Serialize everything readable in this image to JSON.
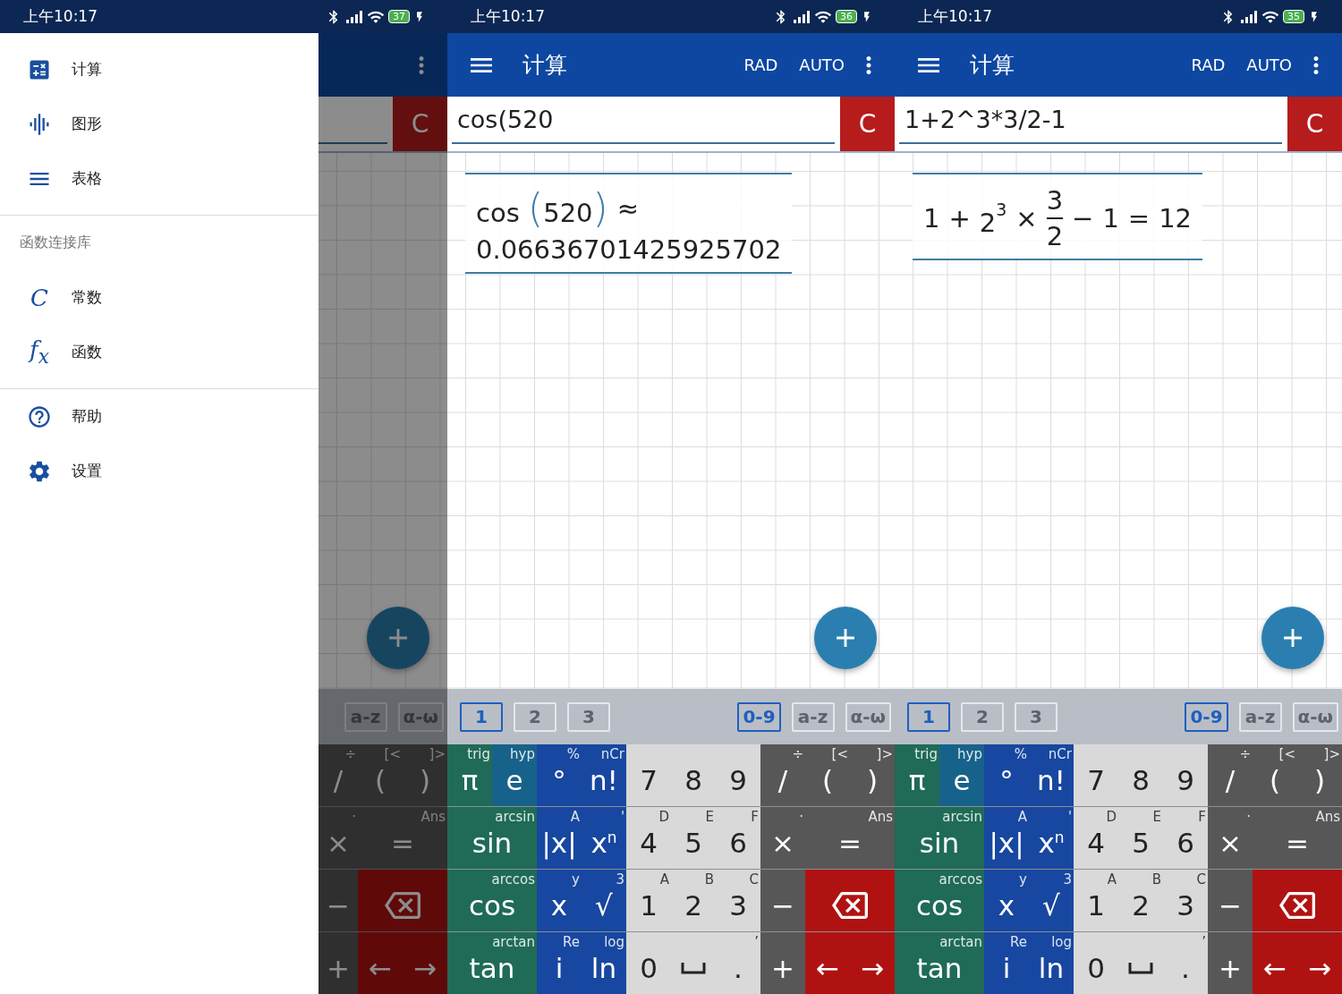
{
  "screens": [
    {
      "kind": "drawer",
      "status_bar": {
        "time": "上午10:17",
        "battery": "37"
      },
      "drawer": {
        "items": [
          {
            "kind": "item",
            "label": "计算"
          },
          {
            "kind": "item",
            "label": "图形"
          },
          {
            "kind": "item",
            "label": "表格"
          },
          {
            "kind": "divider"
          },
          {
            "kind": "header",
            "label": "函数连接库"
          },
          {
            "kind": "glyph-item",
            "glyph": "C",
            "label": "常数"
          },
          {
            "kind": "glyph-item",
            "glyph": "f$_{x}$",
            "label": "函数"
          },
          {
            "kind": "divider"
          },
          {
            "kind": "item",
            "label": "帮助"
          },
          {
            "kind": "item",
            "label": "设置"
          }
        ]
      },
      "background": {
        "clear": "C",
        "sets": [
          {
            "label": "a-z",
            "selected": false
          },
          {
            "label": "α-ω",
            "selected": false
          }
        ],
        "keys": [
          {
            "kind": "operator",
            "wide": false,
            "label": "/",
            "sub": "÷"
          },
          {
            "kind": "operator",
            "wide": false,
            "label": "(",
            "sub": "[<"
          },
          {
            "kind": "operator",
            "wide": false,
            "label": ")",
            "sub": "]>"
          },
          {
            "kind": "operator",
            "wide": false,
            "label": "×",
            "sub": "·"
          },
          {
            "kind": "operator",
            "wide": true,
            "label": "=",
            "sub": "Ans"
          },
          {
            "kind": "operator",
            "wide": false,
            "label": "−"
          },
          {
            "kind": "delete",
            "wide": true
          },
          {
            "kind": "operator",
            "wide": false,
            "label": "+"
          },
          {
            "kind": "nav",
            "wide": false,
            "label": "←"
          },
          {
            "kind": "nav",
            "wide": false,
            "label": "→"
          }
        ]
      }
    },
    {
      "kind": "calculator",
      "status_bar": {
        "time": "上午10:17",
        "battery": "36"
      },
      "toolbar": {
        "title": "计算",
        "angle": "RAD",
        "mode": "AUTO"
      },
      "input": {
        "value": "cos(520",
        "clear": "C"
      },
      "results": [
        {
          "lines": [
            [
              {
                "kind": "func",
                "name": "cos",
                "open": "(",
                "argument": "520",
                "close": ")"
              },
              {
                "kind": "op",
                "text": "≈"
              }
            ],
            [
              {
                "kind": "num",
                "text": "0.06636701425925702"
              }
            ]
          ]
        }
      ],
      "keyboard": {
        "pages": [
          {
            "label": "1",
            "selected": true
          },
          {
            "label": "2",
            "selected": false
          },
          {
            "label": "3",
            "selected": false
          }
        ],
        "sets": [
          {
            "label": "0-9",
            "selected": true
          },
          {
            "label": "a-z",
            "selected": false
          },
          {
            "label": "α-ω",
            "selected": false
          }
        ],
        "keys": [
          {
            "kind": "trig",
            "wide": false,
            "label": "π",
            "sub": "trig"
          },
          {
            "kind": "hyp",
            "wide": false,
            "label": "e",
            "sub": "hyp"
          },
          {
            "kind": "func",
            "wide": false,
            "label": "°",
            "sub": "%"
          },
          {
            "kind": "func",
            "wide": false,
            "label": "n!",
            "sub": "nCr"
          },
          {
            "kind": "digit",
            "wide": false,
            "label": "7"
          },
          {
            "kind": "digit",
            "wide": false,
            "label": "8"
          },
          {
            "kind": "digit",
            "wide": false,
            "label": "9"
          },
          {
            "kind": "operator",
            "wide": false,
            "label": "/",
            "sub": "÷"
          },
          {
            "kind": "operator",
            "wide": false,
            "label": "(",
            "sub": "[<"
          },
          {
            "kind": "operator",
            "wide": false,
            "label": ")",
            "sub": "]>"
          },
          {
            "kind": "trig",
            "wide": true,
            "label": "sin",
            "sub": "arcsin"
          },
          {
            "kind": "func",
            "wide": false,
            "label": "|x|",
            "sub": "A"
          },
          {
            "kind": "func",
            "wide": false,
            "label": "x$^{n}$",
            "sub": "'"
          },
          {
            "kind": "digit",
            "wide": false,
            "label": "4",
            "sub": "D"
          },
          {
            "kind": "digit",
            "wide": false,
            "label": "5",
            "sub": "E"
          },
          {
            "kind": "digit",
            "wide": false,
            "label": "6",
            "sub": "F"
          },
          {
            "kind": "operator",
            "wide": false,
            "label": "×",
            "sub": "·"
          },
          {
            "kind": "operator",
            "wide": true,
            "label": "=",
            "sub": "Ans"
          },
          {
            "kind": "trig",
            "wide": true,
            "label": "cos",
            "sub": "arccos"
          },
          {
            "kind": "func",
            "wide": false,
            "label": "x",
            "sub": "y"
          },
          {
            "kind": "func",
            "wide": false,
            "label": "√",
            "sub": "3"
          },
          {
            "kind": "digit",
            "wide": false,
            "label": "1",
            "sub": "A"
          },
          {
            "kind": "digit",
            "wide": false,
            "label": "2",
            "sub": "B"
          },
          {
            "kind": "digit",
            "wide": false,
            "label": "3",
            "sub": "C"
          },
          {
            "kind": "operator",
            "wide": false,
            "label": "−"
          },
          {
            "kind": "delete",
            "wide": true
          },
          {
            "kind": "trig",
            "wide": true,
            "label": "tan",
            "sub": "arctan"
          },
          {
            "kind": "func",
            "wide": false,
            "label": "i",
            "sub": "Re"
          },
          {
            "kind": "func",
            "wide": false,
            "label": "ln",
            "sub": "log"
          },
          {
            "kind": "digit",
            "wide": false,
            "label": "0"
          },
          {
            "kind": "space",
            "wide": false
          },
          {
            "kind": "digit",
            "wide": false,
            "label": ".",
            "sub": "’"
          },
          {
            "kind": "operator",
            "wide": false,
            "label": "+"
          },
          {
            "kind": "nav",
            "wide": false,
            "label": "←"
          },
          {
            "kind": "nav",
            "wide": false,
            "label": "→"
          }
        ]
      }
    },
    {
      "kind": "calculator",
      "status_bar": {
        "time": "上午10:17",
        "battery": "35"
      },
      "toolbar": {
        "title": "计算",
        "angle": "RAD",
        "mode": "AUTO"
      },
      "input": {
        "value": "1+2^3*3/2-1",
        "clear": "C"
      },
      "results": [
        {
          "lines": [
            [
              {
                "kind": "num",
                "text": "1"
              },
              {
                "kind": "op",
                "text": "+"
              },
              {
                "kind": "power",
                "base": "2",
                "exponent": "3"
              },
              {
                "kind": "op",
                "text": "×"
              },
              {
                "kind": "fraction",
                "numerator": "3",
                "denominator": "2"
              },
              {
                "kind": "op",
                "text": "−"
              },
              {
                "kind": "num",
                "text": "1"
              },
              {
                "kind": "op",
                "text": "="
              },
              {
                "kind": "num",
                "text": "12"
              }
            ]
          ]
        }
      ],
      "keyboard": {
        "pages": [
          {
            "label": "1",
            "selected": true
          },
          {
            "label": "2",
            "selected": false
          },
          {
            "label": "3",
            "selected": false
          }
        ],
        "sets": [
          {
            "label": "0-9",
            "selected": true
          },
          {
            "label": "a-z",
            "selected": false
          },
          {
            "label": "α-ω",
            "selected": false
          }
        ],
        "keys": [
          {
            "kind": "trig",
            "wide": false,
            "label": "π",
            "sub": "trig"
          },
          {
            "kind": "hyp",
            "wide": false,
            "label": "e",
            "sub": "hyp"
          },
          {
            "kind": "func",
            "wide": false,
            "label": "°",
            "sub": "%"
          },
          {
            "kind": "func",
            "wide": false,
            "label": "n!",
            "sub": "nCr"
          },
          {
            "kind": "digit",
            "wide": false,
            "label": "7"
          },
          {
            "kind": "digit",
            "wide": false,
            "label": "8"
          },
          {
            "kind": "digit",
            "wide": false,
            "label": "9"
          },
          {
            "kind": "operator",
            "wide": false,
            "label": "/",
            "sub": "÷"
          },
          {
            "kind": "operator",
            "wide": false,
            "label": "(",
            "sub": "[<"
          },
          {
            "kind": "operator",
            "wide": false,
            "label": ")",
            "sub": "]>"
          },
          {
            "kind": "trig",
            "wide": true,
            "label": "sin",
            "sub": "arcsin"
          },
          {
            "kind": "func",
            "wide": false,
            "label": "|x|",
            "sub": "A"
          },
          {
            "kind": "func",
            "wide": false,
            "label": "x$^{n}$",
            "sub": "'"
          },
          {
            "kind": "digit",
            "wide": false,
            "label": "4",
            "sub": "D"
          },
          {
            "kind": "digit",
            "wide": false,
            "label": "5",
            "sub": "E"
          },
          {
            "kind": "digit",
            "wide": false,
            "label": "6",
            "sub": "F"
          },
          {
            "kind": "operator",
            "wide": false,
            "label": "×",
            "sub": "·"
          },
          {
            "kind": "operator",
            "wide": true,
            "label": "=",
            "sub": "Ans"
          },
          {
            "kind": "trig",
            "wide": true,
            "label": "cos",
            "sub": "arccos"
          },
          {
            "kind": "func",
            "wide": false,
            "label": "x",
            "sub": "y"
          },
          {
            "kind": "func",
            "wide": false,
            "label": "√",
            "sub": "3"
          },
          {
            "kind": "digit",
            "wide": false,
            "label": "1",
            "sub": "A"
          },
          {
            "kind": "digit",
            "wide": false,
            "label": "2",
            "sub": "B"
          },
          {
            "kind": "digit",
            "wide": false,
            "label": "3",
            "sub": "C"
          },
          {
            "kind": "operator",
            "wide": false,
            "label": "−"
          },
          {
            "kind": "delete",
            "wide": true
          },
          {
            "kind": "trig",
            "wide": true,
            "label": "tan",
            "sub": "arctan"
          },
          {
            "kind": "func",
            "wide": false,
            "label": "i",
            "sub": "Re"
          },
          {
            "kind": "func",
            "wide": false,
            "label": "ln",
            "sub": "log"
          },
          {
            "kind": "digit",
            "wide": false,
            "label": "0"
          },
          {
            "kind": "space",
            "wide": false
          },
          {
            "kind": "digit",
            "wide": false,
            "label": ".",
            "sub": "’"
          },
          {
            "kind": "operator",
            "wide": false,
            "label": "+"
          },
          {
            "kind": "nav",
            "wide": false,
            "label": "←"
          },
          {
            "kind": "nav",
            "wide": false,
            "label": "→"
          }
        ]
      }
    }
  ]
}
